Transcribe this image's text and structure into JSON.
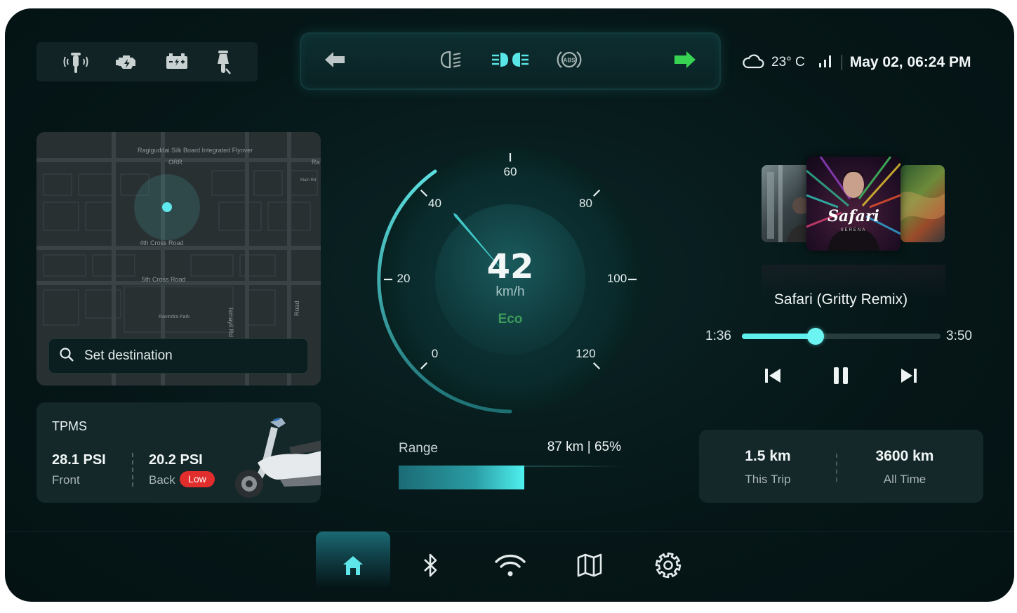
{
  "status_icons": [
    "motorcycle-signal-icon",
    "engine-warning-icon",
    "battery-charge-icon",
    "scooter-stand-icon"
  ],
  "indicators": {
    "left_turn": "arrow-left-icon",
    "headlight": "low-beam-icon",
    "parking_lights": "parking-light-icon",
    "abs": "ABS",
    "right_turn": "arrow-right-icon",
    "right_turn_color": "#39d353"
  },
  "status_bar": {
    "temperature": "23° C",
    "datetime": "May 02, 06:24 PM"
  },
  "map": {
    "labels": {
      "flyover": "Ragiguddai Silk Board Integrated Flyover",
      "orr": "ORR",
      "ra": "Ra",
      "main_rd": "Main Rd",
      "cross4": "4th Cross Road",
      "cross5": "5th Cross Road",
      "park": "Ravindra Park",
      "ismayil": "Ismayil Rd",
      "road_v": "Road"
    },
    "search_placeholder": "Set destination"
  },
  "tpms": {
    "title": "TPMS",
    "front_value": "28.1 PSI",
    "front_label": "Front",
    "back_value": "20.2 PSI",
    "back_label": "Back",
    "back_status": "Low"
  },
  "speedometer": {
    "speed": "42",
    "unit": "km/h",
    "mode": "Eco",
    "ticks": [
      "0",
      "20",
      "40",
      "60",
      "80",
      "100",
      "120"
    ],
    "accent": "#3fcfcf"
  },
  "range": {
    "label": "Range",
    "value": "87 km | 65%",
    "fraction": 0.56
  },
  "media": {
    "album_text": "Safari",
    "album_sub": "SERENA",
    "song_title": "Safari (Gritty Remix)",
    "current_time": "1:36",
    "total_time": "3:50",
    "progress": 0.37
  },
  "trip": {
    "trip_value": "1.5 km",
    "trip_label": "This Trip",
    "total_value": "3600 km",
    "total_label": "All Time"
  },
  "nav": {
    "items": [
      "home-icon",
      "bluetooth-icon",
      "wifi-icon",
      "map-icon",
      "settings-icon"
    ],
    "active": "home-icon"
  }
}
